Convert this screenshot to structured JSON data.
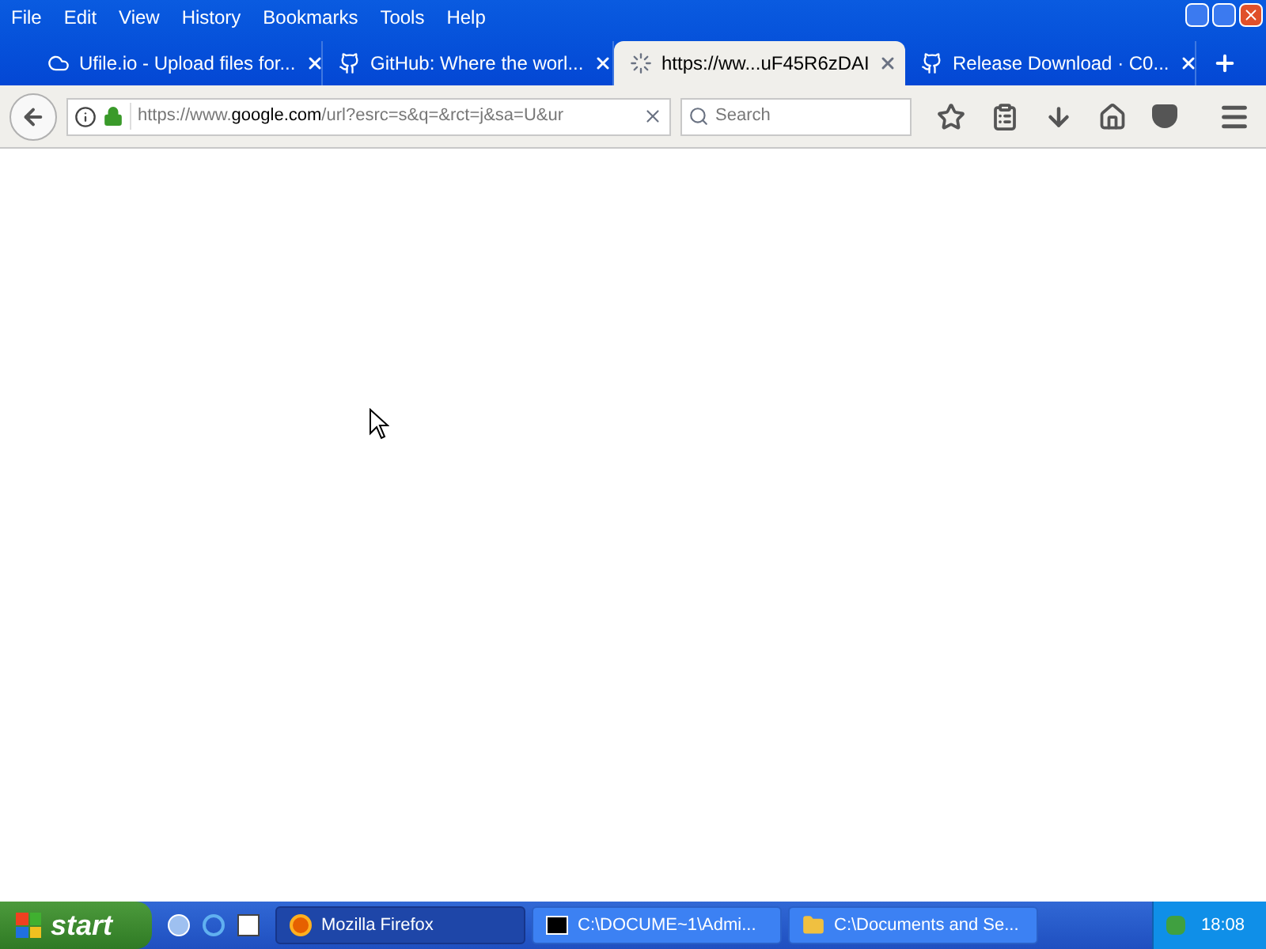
{
  "menu": [
    "File",
    "Edit",
    "View",
    "History",
    "Bookmarks",
    "Tools",
    "Help"
  ],
  "tabs": [
    {
      "title": "Ufile.io - Upload files for...",
      "kind": "cloud",
      "selected": false
    },
    {
      "title": "GitHub: Where the worl...",
      "kind": "github",
      "selected": false
    },
    {
      "title": "https://ww...uF45R6zDAI",
      "kind": "loading",
      "selected": true
    },
    {
      "title": "Release Download · C0...",
      "kind": "github",
      "selected": false
    }
  ],
  "url": {
    "prefix": "https://www.",
    "domain": "google.com",
    "path": "/url?esrc=s&q=&rct=j&sa=U&ur"
  },
  "search": {
    "placeholder": "Search"
  },
  "taskbar": {
    "start": "start",
    "tasks": [
      {
        "title": "Mozilla Firefox",
        "kind": "firefox",
        "selected": true
      },
      {
        "title": "C:\\DOCUME~1\\Admi...",
        "kind": "archive",
        "selected": false
      },
      {
        "title": "C:\\Documents and Se...",
        "kind": "folder",
        "selected": false
      }
    ],
    "clock": "18:08"
  }
}
